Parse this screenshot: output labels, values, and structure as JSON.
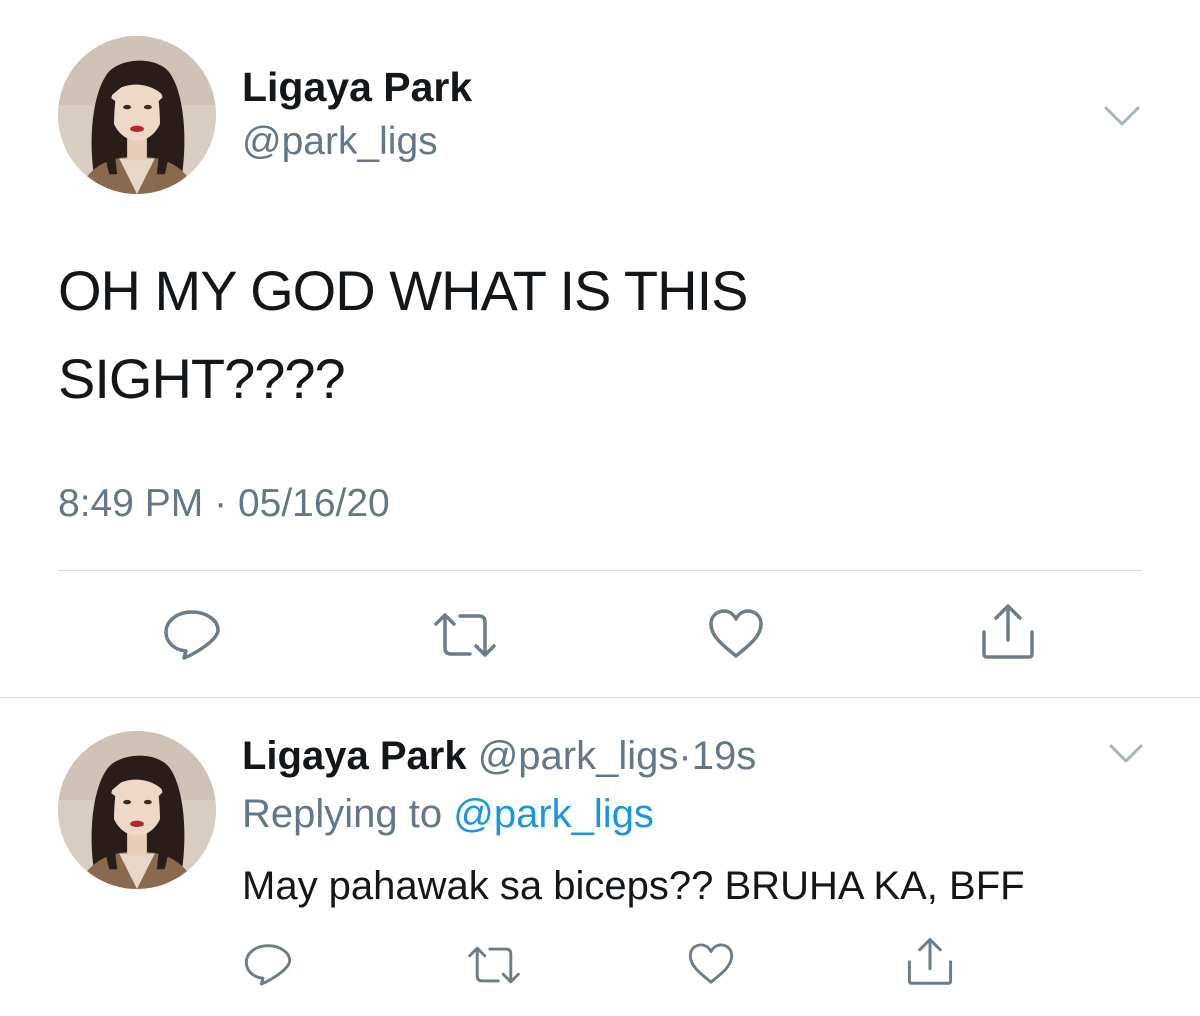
{
  "tweet": {
    "author_name": "Ligaya Park",
    "author_handle": "@park_ligs",
    "text_line1": "OH MY GOD WHAT IS THIS",
    "text_line2": "SIGHT????",
    "time": "8:49 PM",
    "separator": "·",
    "date": "05/16/20",
    "avatar_icon": "profile-photo",
    "menu_icon": "chevron-down-icon",
    "actions": [
      "reply-icon",
      "retweet-icon",
      "like-icon",
      "share-icon"
    ]
  },
  "reply": {
    "author_name": "Ligaya Park",
    "author_handle": "@park_ligs",
    "dot": "·",
    "age": "19s",
    "replying_label": "Replying to",
    "replying_handle": "@park_ligs",
    "text": "May pahawak sa biceps?? BRUHA KA, BFF",
    "avatar_icon": "profile-photo",
    "menu_icon": "chevron-down-icon",
    "actions": [
      "reply-icon",
      "retweet-icon",
      "like-icon",
      "share-icon"
    ]
  },
  "colors": {
    "text": "#14171a",
    "muted": "#657786",
    "link": "#1b95e0",
    "divider": "#d8dde2"
  }
}
